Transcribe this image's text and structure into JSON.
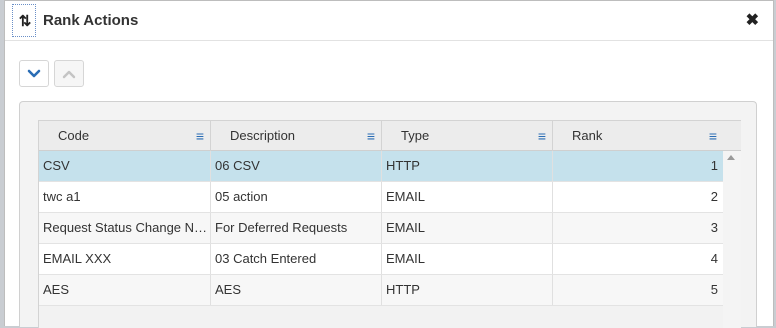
{
  "dialog": {
    "title": "Rank Actions",
    "title_icon_glyph": "⇅",
    "close_glyph": "✖"
  },
  "toolbar": {
    "move_down_icon": "chevron-down-icon",
    "move_up_icon": "chevron-up-icon"
  },
  "grid": {
    "columns": [
      {
        "label": "Code",
        "menu_glyph": "≡"
      },
      {
        "label": "Description",
        "menu_glyph": "≡"
      },
      {
        "label": "Type",
        "menu_glyph": "≡"
      },
      {
        "label": "Rank",
        "menu_glyph": "≡"
      }
    ],
    "rows": [
      {
        "code": "CSV",
        "description": "06 CSV",
        "type": "HTTP",
        "rank": "1"
      },
      {
        "code": "twc a1",
        "description": "05 action",
        "type": "EMAIL",
        "rank": "2"
      },
      {
        "code": "Request Status Change Notification",
        "description": "For Deferred Requests",
        "type": "EMAIL",
        "rank": "3"
      },
      {
        "code": "EMAIL XXX",
        "description": "03 Catch Entered",
        "type": "EMAIL",
        "rank": "4"
      },
      {
        "code": "AES",
        "description": "AES",
        "type": "HTTP",
        "rank": "5"
      }
    ],
    "selected_row": 0
  },
  "colors": {
    "accent": "#2a6db5",
    "selected_row": "#c5e1ec"
  }
}
